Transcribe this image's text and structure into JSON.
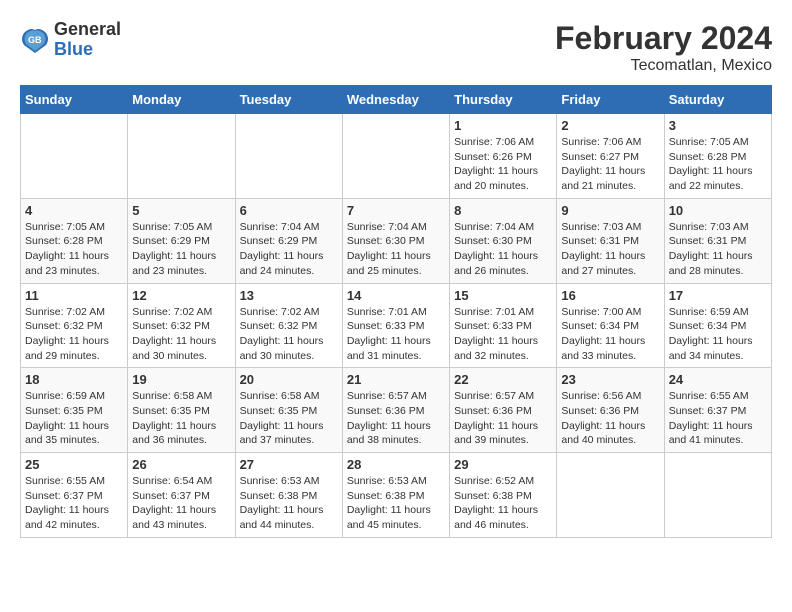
{
  "logo": {
    "general": "General",
    "blue": "Blue"
  },
  "title": "February 2024",
  "subtitle": "Tecomatlan, Mexico",
  "days_of_week": [
    "Sunday",
    "Monday",
    "Tuesday",
    "Wednesday",
    "Thursday",
    "Friday",
    "Saturday"
  ],
  "weeks": [
    [
      {
        "day": "",
        "info": ""
      },
      {
        "day": "",
        "info": ""
      },
      {
        "day": "",
        "info": ""
      },
      {
        "day": "",
        "info": ""
      },
      {
        "day": "1",
        "info": "Sunrise: 7:06 AM\nSunset: 6:26 PM\nDaylight: 11 hours and 20 minutes."
      },
      {
        "day": "2",
        "info": "Sunrise: 7:06 AM\nSunset: 6:27 PM\nDaylight: 11 hours and 21 minutes."
      },
      {
        "day": "3",
        "info": "Sunrise: 7:05 AM\nSunset: 6:28 PM\nDaylight: 11 hours and 22 minutes."
      }
    ],
    [
      {
        "day": "4",
        "info": "Sunrise: 7:05 AM\nSunset: 6:28 PM\nDaylight: 11 hours and 23 minutes."
      },
      {
        "day": "5",
        "info": "Sunrise: 7:05 AM\nSunset: 6:29 PM\nDaylight: 11 hours and 23 minutes."
      },
      {
        "day": "6",
        "info": "Sunrise: 7:04 AM\nSunset: 6:29 PM\nDaylight: 11 hours and 24 minutes."
      },
      {
        "day": "7",
        "info": "Sunrise: 7:04 AM\nSunset: 6:30 PM\nDaylight: 11 hours and 25 minutes."
      },
      {
        "day": "8",
        "info": "Sunrise: 7:04 AM\nSunset: 6:30 PM\nDaylight: 11 hours and 26 minutes."
      },
      {
        "day": "9",
        "info": "Sunrise: 7:03 AM\nSunset: 6:31 PM\nDaylight: 11 hours and 27 minutes."
      },
      {
        "day": "10",
        "info": "Sunrise: 7:03 AM\nSunset: 6:31 PM\nDaylight: 11 hours and 28 minutes."
      }
    ],
    [
      {
        "day": "11",
        "info": "Sunrise: 7:02 AM\nSunset: 6:32 PM\nDaylight: 11 hours and 29 minutes."
      },
      {
        "day": "12",
        "info": "Sunrise: 7:02 AM\nSunset: 6:32 PM\nDaylight: 11 hours and 30 minutes."
      },
      {
        "day": "13",
        "info": "Sunrise: 7:02 AM\nSunset: 6:32 PM\nDaylight: 11 hours and 30 minutes."
      },
      {
        "day": "14",
        "info": "Sunrise: 7:01 AM\nSunset: 6:33 PM\nDaylight: 11 hours and 31 minutes."
      },
      {
        "day": "15",
        "info": "Sunrise: 7:01 AM\nSunset: 6:33 PM\nDaylight: 11 hours and 32 minutes."
      },
      {
        "day": "16",
        "info": "Sunrise: 7:00 AM\nSunset: 6:34 PM\nDaylight: 11 hours and 33 minutes."
      },
      {
        "day": "17",
        "info": "Sunrise: 6:59 AM\nSunset: 6:34 PM\nDaylight: 11 hours and 34 minutes."
      }
    ],
    [
      {
        "day": "18",
        "info": "Sunrise: 6:59 AM\nSunset: 6:35 PM\nDaylight: 11 hours and 35 minutes."
      },
      {
        "day": "19",
        "info": "Sunrise: 6:58 AM\nSunset: 6:35 PM\nDaylight: 11 hours and 36 minutes."
      },
      {
        "day": "20",
        "info": "Sunrise: 6:58 AM\nSunset: 6:35 PM\nDaylight: 11 hours and 37 minutes."
      },
      {
        "day": "21",
        "info": "Sunrise: 6:57 AM\nSunset: 6:36 PM\nDaylight: 11 hours and 38 minutes."
      },
      {
        "day": "22",
        "info": "Sunrise: 6:57 AM\nSunset: 6:36 PM\nDaylight: 11 hours and 39 minutes."
      },
      {
        "day": "23",
        "info": "Sunrise: 6:56 AM\nSunset: 6:36 PM\nDaylight: 11 hours and 40 minutes."
      },
      {
        "day": "24",
        "info": "Sunrise: 6:55 AM\nSunset: 6:37 PM\nDaylight: 11 hours and 41 minutes."
      }
    ],
    [
      {
        "day": "25",
        "info": "Sunrise: 6:55 AM\nSunset: 6:37 PM\nDaylight: 11 hours and 42 minutes."
      },
      {
        "day": "26",
        "info": "Sunrise: 6:54 AM\nSunset: 6:37 PM\nDaylight: 11 hours and 43 minutes."
      },
      {
        "day": "27",
        "info": "Sunrise: 6:53 AM\nSunset: 6:38 PM\nDaylight: 11 hours and 44 minutes."
      },
      {
        "day": "28",
        "info": "Sunrise: 6:53 AM\nSunset: 6:38 PM\nDaylight: 11 hours and 45 minutes."
      },
      {
        "day": "29",
        "info": "Sunrise: 6:52 AM\nSunset: 6:38 PM\nDaylight: 11 hours and 46 minutes."
      },
      {
        "day": "",
        "info": ""
      },
      {
        "day": "",
        "info": ""
      }
    ]
  ]
}
